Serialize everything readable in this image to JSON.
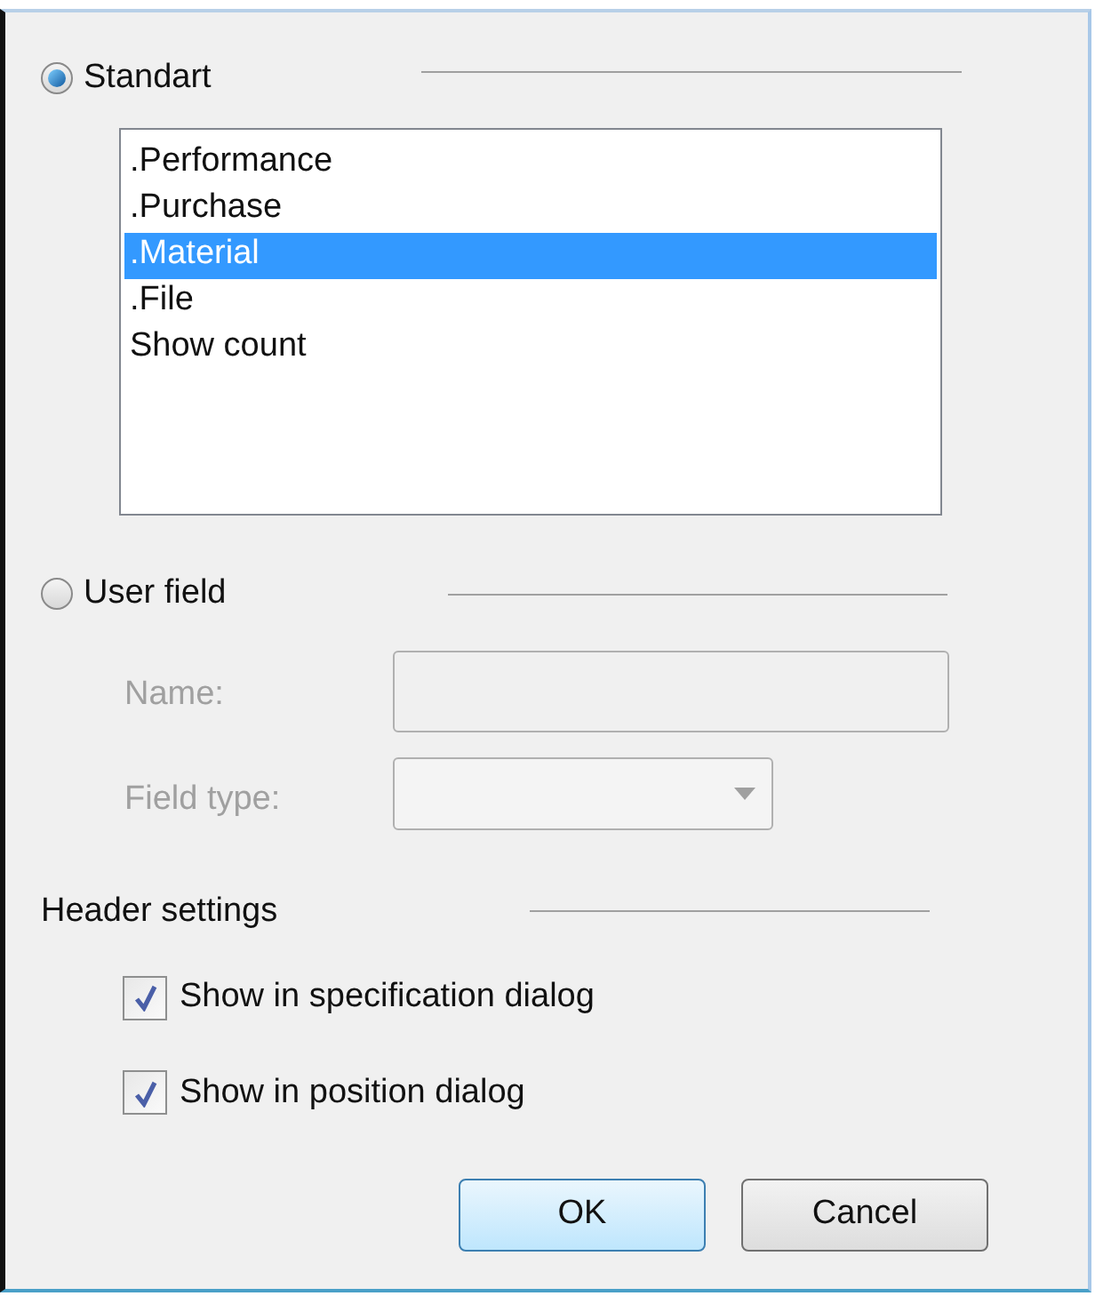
{
  "source_group": {
    "options": [
      {
        "label": "Standart",
        "selected": true
      },
      {
        "label": "User field",
        "selected": false
      }
    ]
  },
  "standard_list": {
    "items": [
      {
        "label": ".Performance",
        "selected": false
      },
      {
        "label": ".Purchase",
        "selected": false
      },
      {
        "label": ".Material",
        "selected": true
      },
      {
        "label": ".File",
        "selected": false
      },
      {
        "label": "Show count",
        "selected": false
      }
    ]
  },
  "user_field": {
    "disabled": true,
    "name_label": "Name:",
    "field_type_label": "Field type:"
  },
  "header_settings": {
    "title": "Header settings",
    "checkboxes": [
      {
        "label": "Show in specification dialog",
        "checked": true
      },
      {
        "label": "Show in position dialog",
        "checked": true
      }
    ]
  },
  "buttons": [
    {
      "label": "OK",
      "default": true
    },
    {
      "label": "Cancel",
      "default": false
    }
  ]
}
